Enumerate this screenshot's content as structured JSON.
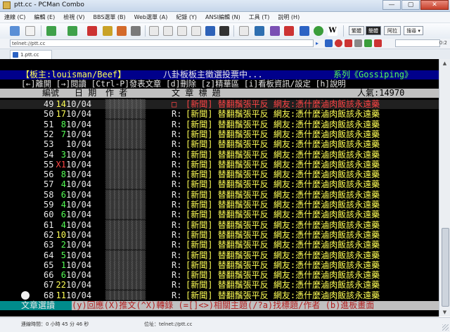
{
  "window": {
    "title": "ptt.cc - PCMan Combo",
    "buttons": [
      "—",
      "▢",
      "✕"
    ]
  },
  "menu": [
    "連線 (C)",
    "編輯 (E)",
    "檢視 (V)",
    "BBS選單 (B)",
    "Web選單 (A)",
    "紀錄 (Y)",
    "ANSI編輯 (N)",
    "工具 (T)",
    "說明 (H)"
  ],
  "toolbar": {
    "right_buttons": [
      "繁體",
      "簡體",
      "阿拉"
    ],
    "dropdown": "搜尋 ▾"
  },
  "address": {
    "value": "telnet://ptt.cc",
    "zoom": "0:2"
  },
  "tab": {
    "label": "1.ptt.cc"
  },
  "colors": {
    "terminal_bg": "#000000",
    "header_bar": "#00008b",
    "column_bar": "#c0c0c0",
    "footer_bar": "#008b8b"
  },
  "terminal": {
    "header": {
      "board_master": "【板主:louisman/Beef】",
      "notice": "八卦板板主徵選投票中...",
      "series": "系列《Gossiping》"
    },
    "help": "[←]離開 [→]閱讀 [Ctrl-P]發表文章 [d]刪除 [z]精華區 [i]看板資訊/設定 [h]說明",
    "columns": {
      "number": "編號",
      "date": "日 期",
      "author": "作 者",
      "title": "文  章  標  題",
      "popularity": "人氣:14970"
    },
    "rows": [
      {
        "num": "49",
        "push": "14",
        "date": "10/04",
        "prefix": "□",
        "title": "[新聞] 替翻鬚張平反 網友:憑什麼滷肉飯該永遠藥",
        "selected": true
      },
      {
        "num": "50",
        "push": "17",
        "date": "10/04",
        "prefix": "R:",
        "title": "[新聞] 替翻鬚張平反 網友:憑什麼滷肉飯該永遠藥"
      },
      {
        "num": "51",
        "push": "8",
        "date": "10/04",
        "prefix": "R:",
        "title": "[新聞] 替翻鬚張平反 網友:憑什麼滷肉飯該永遠藥"
      },
      {
        "num": "52",
        "push": "7",
        "date": "10/04",
        "prefix": "R:",
        "title": "[新聞] 替翻鬚張平反 網友:憑什麼滷肉飯該永遠藥"
      },
      {
        "num": "53",
        "push": "",
        "date": "10/04",
        "prefix": "R:",
        "title": "[新聞] 替翻鬚張平反 網友:憑什麼滷肉飯該永遠藥"
      },
      {
        "num": "54",
        "push": "3",
        "date": "10/04",
        "prefix": "R:",
        "title": "[新聞] 替翻鬚張平反 網友:憑什麼滷肉飯該永遠藥"
      },
      {
        "num": "55",
        "push": "X1",
        "date": "10/04",
        "prefix": "R:",
        "title": "[新聞] 替翻鬚張平反 網友:憑什麼滷肉飯該永遠藥"
      },
      {
        "num": "56",
        "push": "8",
        "date": "10/04",
        "prefix": "R:",
        "title": "[新聞] 替翻鬚張平反 網友:憑什麼滷肉飯該永遠藥"
      },
      {
        "num": "57",
        "push": "4",
        "date": "10/04",
        "prefix": "R:",
        "title": "[新聞] 替翻鬚張平反 網友:憑什麼滷肉飯該永遠藥"
      },
      {
        "num": "58",
        "push": "6",
        "date": "10/04",
        "prefix": "R:",
        "title": "[新聞] 替翻鬚張平反 網友:憑什麼滷肉飯該永遠藥"
      },
      {
        "num": "59",
        "push": "4",
        "date": "10/04",
        "prefix": "R:",
        "title": "[新聞] 替翻鬚張平反 網友:憑什麼滷肉飯該永遠藥"
      },
      {
        "num": "60",
        "push": "6",
        "date": "10/04",
        "prefix": "R:",
        "title": "[新聞] 替翻鬚張平反 網友:憑什麼滷肉飯該永遠藥"
      },
      {
        "num": "61",
        "push": "4",
        "date": "10/04",
        "prefix": "R:",
        "title": "[新聞] 替翻鬚張平反 網友:憑什麼滷肉飯該永遠藥"
      },
      {
        "num": "62",
        "push": "10",
        "date": "10/04",
        "prefix": "R:",
        "title": "[新聞] 替翻鬚張平反 網友:憑什麼滷肉飯該永遠藥"
      },
      {
        "num": "63",
        "push": "2",
        "date": "10/04",
        "prefix": "R:",
        "title": "[新聞] 替翻鬚張平反 網友:憑什麼滷肉飯該永遠藥"
      },
      {
        "num": "64",
        "push": "5",
        "date": "10/04",
        "prefix": "R:",
        "title": "[新聞] 替翻鬚張平反 網友:憑什麼滷肉飯該永遠藥"
      },
      {
        "num": "65",
        "push": "1",
        "date": "10/04",
        "prefix": "R:",
        "title": "[新聞] 替翻鬚張平反 網友:憑什麼滷肉飯該永遠藥"
      },
      {
        "num": "66",
        "push": "6",
        "date": "10/04",
        "prefix": "R:",
        "title": "[新聞] 替翻鬚張平反 網友:憑什麼滷肉飯該永遠藥"
      },
      {
        "num": "67",
        "push": "22",
        "date": "10/04",
        "prefix": "R:",
        "title": "[新聞] 替翻鬚張平反 網友:憑什麼滷肉飯該永遠藥"
      },
      {
        "num": "68",
        "push": "11",
        "date": "10/04",
        "prefix": "R:",
        "title": "[新聞] 替翻鬚張平反 網友:憑什麼滷肉飯該永遠藥"
      }
    ],
    "footer": {
      "label": "文章選讀",
      "keys": "(y)回應(X)推文(^X)轉錄 (=[]<>)相關主題(/?a)找標題/作者 (b)進板畫面"
    }
  },
  "status": {
    "connect_time": "連線時間：0 小時 45 分 46 秒",
    "location": "位址：telnet://ptt.cc"
  }
}
